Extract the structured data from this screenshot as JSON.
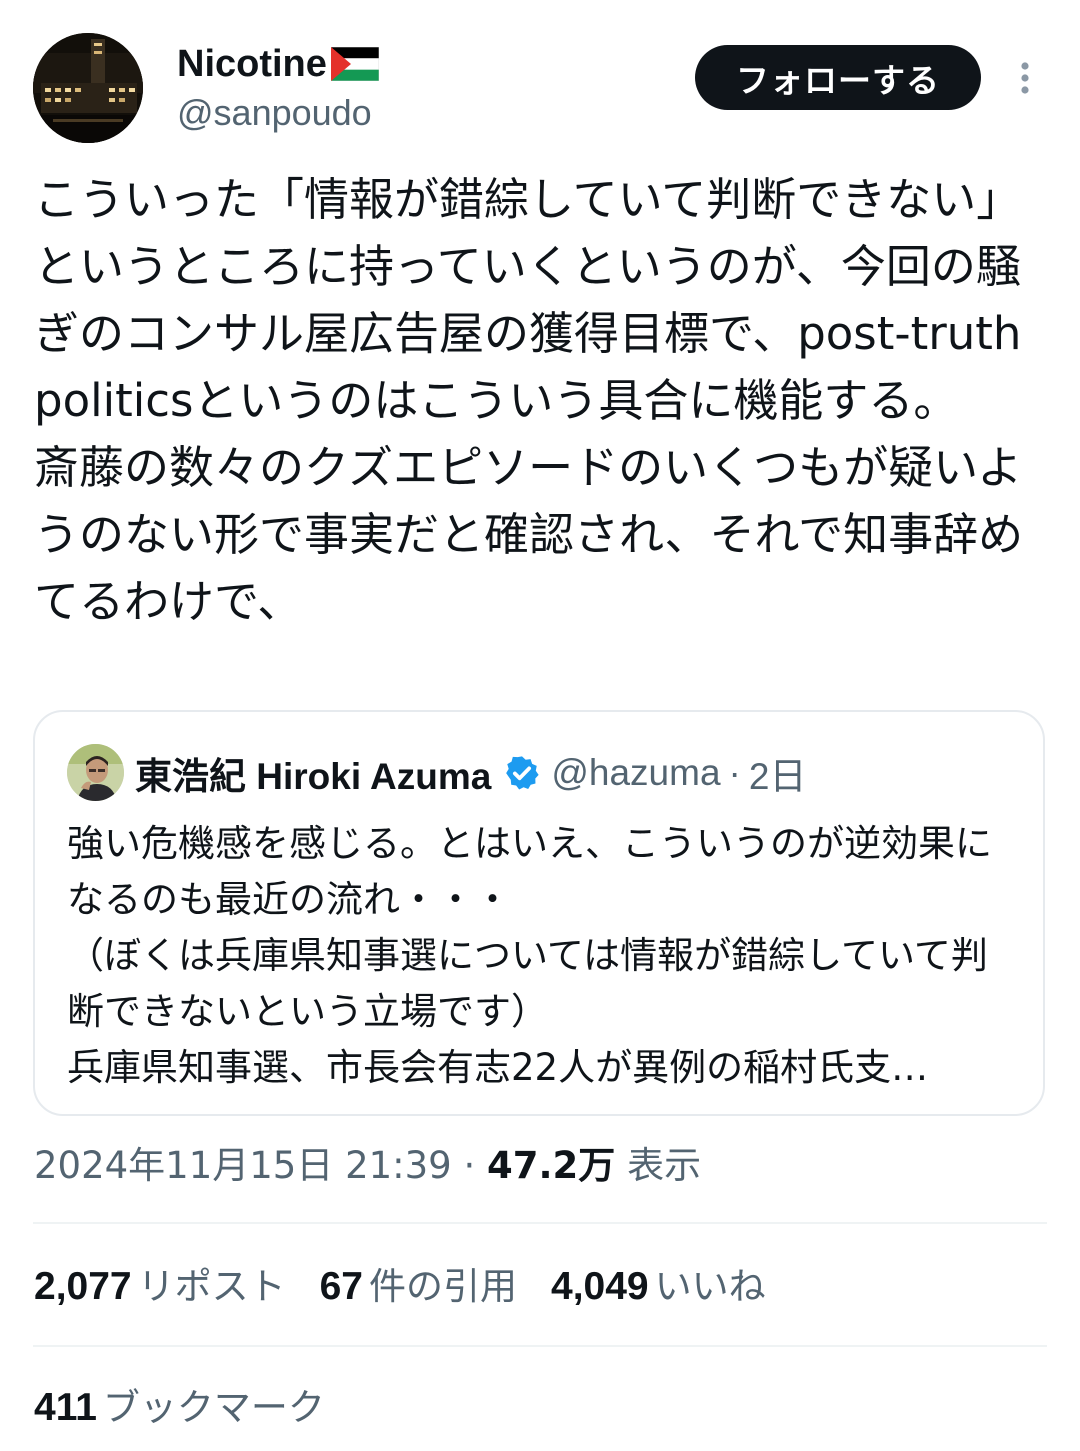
{
  "author": {
    "display_name": "Nicotine",
    "flag_icon": "palestine-flag-icon",
    "handle": "@sanpoudo"
  },
  "follow_button": {
    "label": "フォローする"
  },
  "more_icon": "more-vertical-icon",
  "tweet": {
    "text": "こういった「情報が錯綜していて判断できない」というところに持っていくというのが、今回の騒ぎのコンサル屋広告屋の獲得目標で、post-truth politicsというのはこういう具合に機能する。\n斎藤の数々のクズエピソードのいくつもが疑いようのない形で事実だと確認され、それで知事辞めてるわけで、"
  },
  "quote": {
    "display_name": "東浩紀 Hiroki Azuma",
    "verified_icon": "verified-badge-icon",
    "handle": "@hazuma",
    "separator": "·",
    "time_ago": "2日",
    "text": "強い危機感を感じる。とはいえ、こういうのが逆効果になるのも最近の流れ・・・\n（ぼくは兵庫県知事選については情報が錯綜していて判断できないという立場です）",
    "text_last_line": "兵庫県知事選、市長会有志22人が異例の稲村氏支…"
  },
  "meta": {
    "timestamp": "2024年11月15日 21:39",
    "separator": "·",
    "views_count": "47.2万",
    "views_label": "表示"
  },
  "stats": {
    "reposts_count": "2,077",
    "reposts_label": "リポスト",
    "quotes_count": "67",
    "quotes_label": "件の引用",
    "likes_count": "4,049",
    "likes_label": "いいね",
    "bookmarks_count": "411",
    "bookmarks_label": "ブックマーク"
  },
  "colors": {
    "text_primary": "#0f1419",
    "text_secondary": "#536471",
    "follow_button_bg": "#0f1419",
    "verified_blue": "#1d9bf0",
    "border": "#e6eaee"
  }
}
